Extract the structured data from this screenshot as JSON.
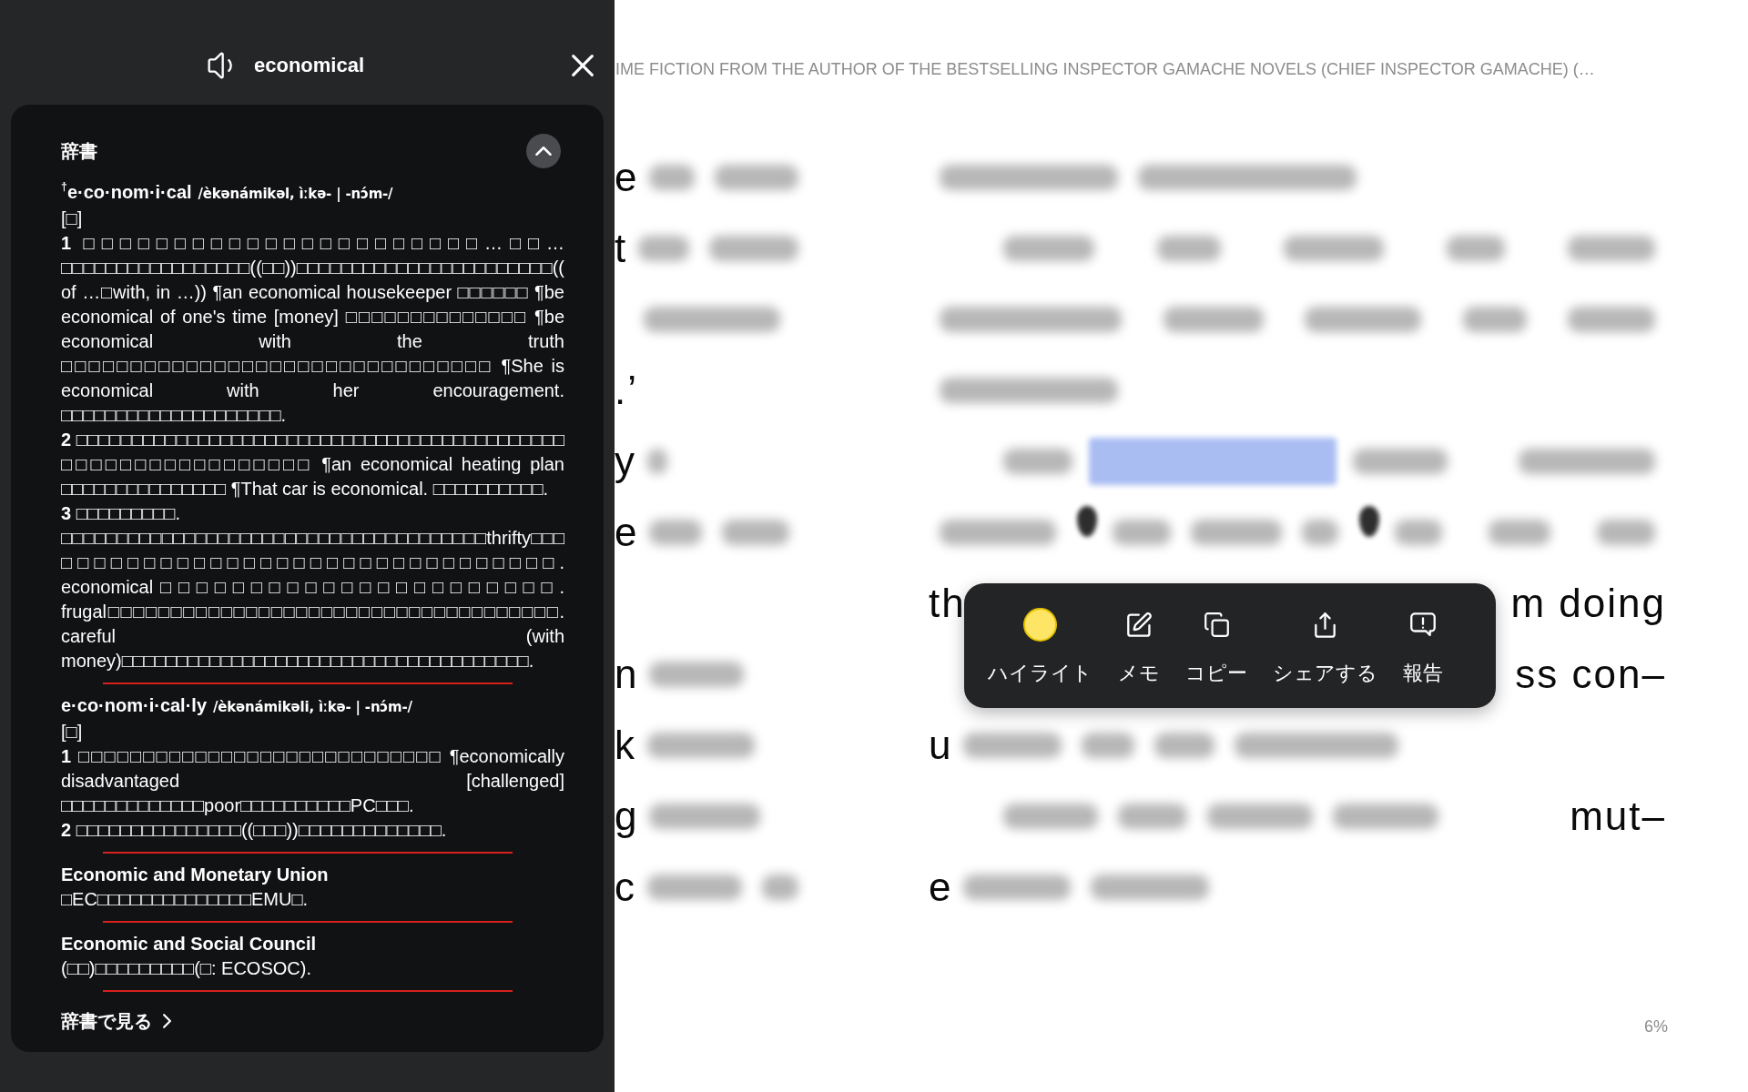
{
  "dictionary_panel": {
    "word": "economical",
    "section": {
      "title": "辞書",
      "expanded": true
    },
    "entries": [
      {
        "headword": "$^{†}$e·co·nom·i·cal",
        "pronunciation": "/èkənámikəl, ìːkə- | -nɔ́m-/",
        "part_of_speech": "[□]",
        "definitions": [
          "**1** □□□□□□□□□□□□□□□□□□□□□□…□□…□□□□□□□□□□□□□□□□□((□□))□□□□□□□□□□□□□□□□□□□□□□□((of …□with, in …)) ¶an economical housekeeper □□□□□□ ¶be economical of one's time [money] □□□□□□□□□□□□□□ ¶be economical with the truth □□□□□□□□□□□□□□□□□□□□□□□□□□□□□□□ ¶She is economical with her encouragement. □□□□□□□□□□□□□□□□□□□□.",
          "**2** □□□□□□□□□□□□□□□□□□□□□□□□□□□□□□□□□□□□□□□□□□□□□□□□□□□□□□□□□□□□□ ¶an economical heating plan □□□□□□□□□□□□□□□ ¶That car is economical. □□□□□□□□□□.",
          "**3** □□□□□□□□□.",
          "□□□□□□□□□□□□□□□□□□□□□□□□□□□□□□□□□□□□□□thrifty□□□□□□□□□□□□□□□□□□□□□□□□□□□□□□□□□. economical□□□□□□□□□□□□□□□□□□□□□□. frugal□□□□□□□□□□□□□□□□□□□□□□□□□□□□□□□□□□□□. careful (with money)□□□□□□□□□□□□□□□□□□□□□□□□□□□□□□□□□□□□□."
        ]
      },
      {
        "headword": "e·co·nom·i·cal·ly",
        "pronunciation": "/èkənámikəli, ìːkə- | -nɔ́m-/",
        "part_of_speech": "[□]",
        "definitions": [
          "**1** □□□□□□□□□□□□□□□□□□□□□□□□□□□□ ¶economically disadvantaged [challenged] □□□□□□□□□□□□□poor□□□□□□□□□□PC□□□.",
          "**2** □□□□□□□□□□□□□□□((□□□))□□□□□□□□□□□□□."
        ]
      },
      {
        "headword": "Economic and Monetary Union",
        "definitions": [
          "□EC□□□□□□□□□□□□□□EMU□."
        ]
      },
      {
        "headword": "Economic and Social Council",
        "definitions": [
          "(□□)□□□□□□□□□(□: ECOSOC)."
        ]
      }
    ],
    "more_link": "辞書で見る"
  },
  "book": {
    "running_title": "IME FICTION FROM THE AUTHOR OF THE BESTSELLING INSPECTOR GAMACHE NOVELS (CHIEF INSPECTOR GAMACHE) (…",
    "left_column_fragments": [
      "e",
      "t",
      ".’",
      "y",
      "e",
      "n",
      "k",
      "g",
      "c"
    ],
    "right_column_fragments": [
      "th",
      "m doing",
      "ss con–",
      "u",
      "mut–",
      "e"
    ],
    "progress": "6%"
  },
  "selection_menu": {
    "items": [
      {
        "kind": "highlight",
        "label": "ハイライト"
      },
      {
        "kind": "note",
        "label": "メモ"
      },
      {
        "kind": "copy",
        "label": "コピー"
      },
      {
        "kind": "share",
        "label": "シェアする"
      },
      {
        "kind": "report",
        "label": "報告"
      }
    ]
  }
}
